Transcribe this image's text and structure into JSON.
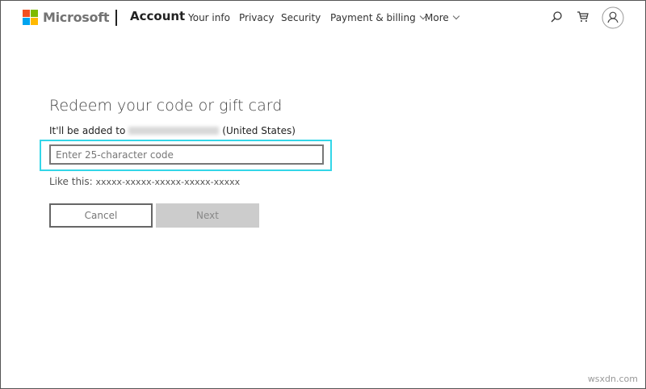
{
  "header": {
    "brand": "Microsoft",
    "section": "Account",
    "nav": [
      {
        "label": "Your info"
      },
      {
        "label": "Privacy"
      },
      {
        "label": "Security"
      },
      {
        "label": "Payment & billing",
        "has_dropdown": true
      },
      {
        "label": "More",
        "has_dropdown": true
      }
    ],
    "icons": [
      "search-icon",
      "cart-icon",
      "account-avatar-icon"
    ]
  },
  "main": {
    "title": "Redeem your code or gift card",
    "added_prefix": "It'll be added to",
    "added_suffix": "(United States)",
    "code_input": {
      "value": "",
      "placeholder": "Enter 25-character code"
    },
    "hint_label": "Like this:",
    "hint_example": "xxxxx-xxxxx-xxxxx-xxxxx-xxxxx",
    "cancel_label": "Cancel",
    "next_label": "Next"
  },
  "colors": {
    "highlight": "#33d6e8",
    "ms_red": "#f25022",
    "ms_green": "#7fba00",
    "ms_blue": "#00a4ef",
    "ms_yellow": "#ffb900"
  },
  "watermark": "wsxdn.com"
}
